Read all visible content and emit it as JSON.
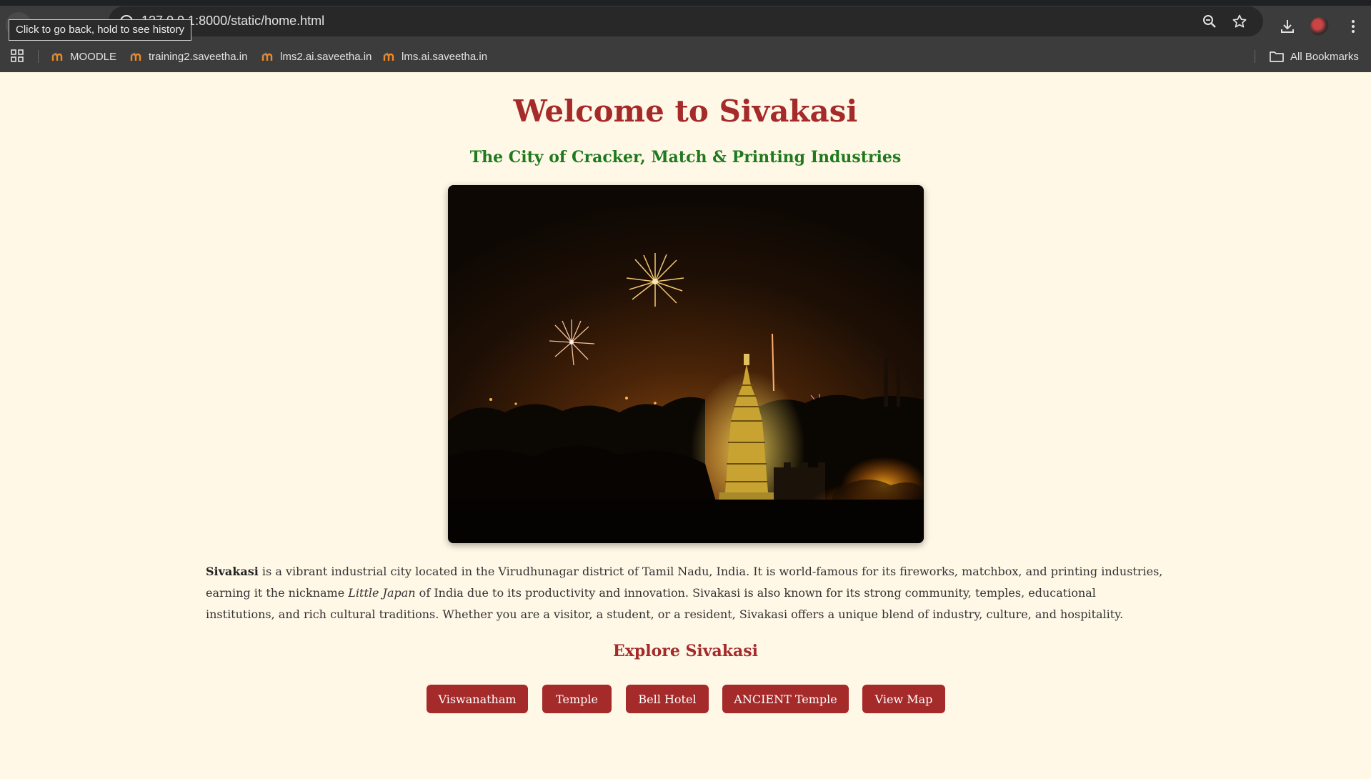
{
  "browser": {
    "url": "127.0.0.1:8000/static/home.html",
    "url_visible": "8000/static/home.html",
    "tooltip": "Click to go back, hold to see history",
    "bookmarks": [
      {
        "label": "MOODLE",
        "icon": "moodle-icon"
      },
      {
        "label": "training2.saveetha.in",
        "icon": "moodle-icon"
      },
      {
        "label": "lms2.ai.saveetha.in",
        "icon": "moodle-icon"
      },
      {
        "label": "lms.ai.saveetha.in",
        "icon": "moodle-icon"
      }
    ],
    "all_bookmarks_label": "All Bookmarks"
  },
  "page": {
    "title": "Welcome to Sivakasi",
    "subtitle": "The City of Cracker, Match & Printing Industries",
    "hero_image": "Night view of Sivakasi with fireworks above a lit temple tower",
    "intro": {
      "bold": "Sivakasi",
      "part1": " is a vibrant industrial city located in the Virudhunagar district of Tamil Nadu, India. It is world-famous for its fireworks, matchbox, and printing industries, earning it the nickname ",
      "italic": "Little Japan",
      "part2": " of India due to its productivity and innovation. Sivakasi is also known for its strong community, temples, educational institutions, and rich cultural traditions. Whether you are a visitor, a student, or a resident, Sivakasi offers a unique blend of industry, culture, and hospitality."
    },
    "explore_heading": "Explore Sivakasi",
    "buttons": [
      "Viswanatham",
      "Temple",
      "Bell Hotel",
      "ANCIENT Temple",
      "View Map"
    ]
  },
  "colors": {
    "background": "#fff8e7",
    "title": "#a52a2a",
    "subtitle": "#1e7a1e",
    "button": "#a52a2a",
    "button_text": "#ffffff"
  }
}
